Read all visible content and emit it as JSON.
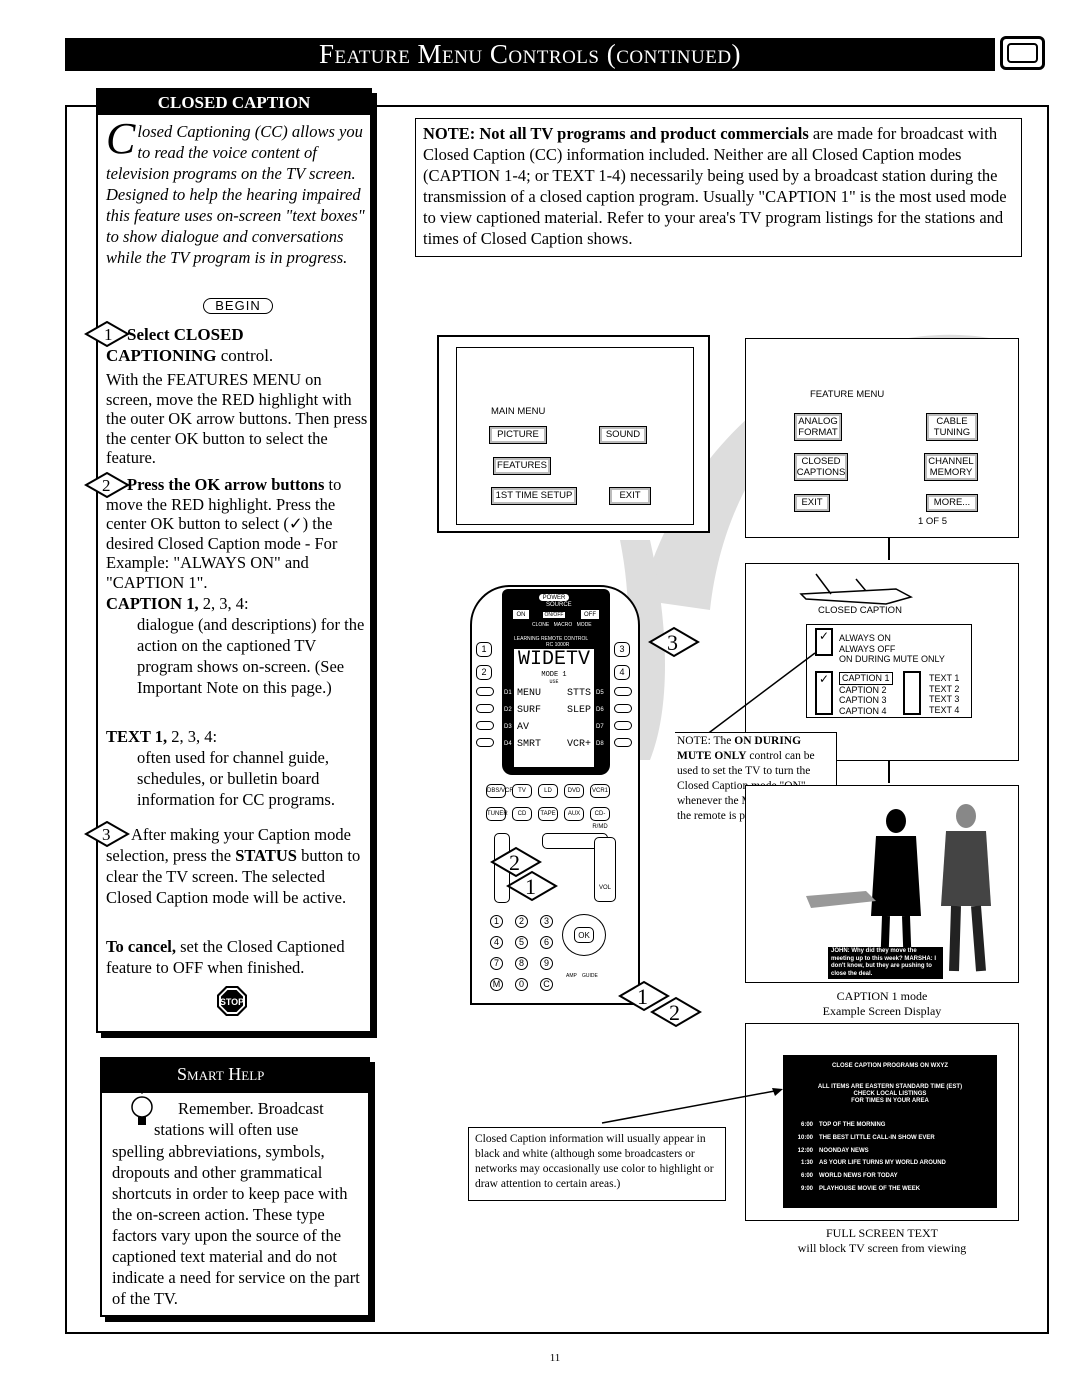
{
  "header": {
    "title": "Feature Menu Controls (continued)",
    "icon": "tv-icon"
  },
  "closed_caption": {
    "heading": "CLOSED CAPTION",
    "intro_dropcap": "C",
    "intro": "losed Captioning (CC) allows you to read the voice content of television programs on the TV screen. Designed to help the hearing impaired this feature uses on-screen \"text boxes\" to show dialogue and conversations while the TV program is in progress.",
    "begin": "BEGIN",
    "step1_num": "1",
    "step1_title_a": "Select CLOSED",
    "step1_title_b": "CAPTIONING",
    "step1_title_c": " control.",
    "step1_body": "With the FEATURES MENU on screen, move the RED highlight with the outer OK arrow buttons. Then press the center OK button to select the feature.",
    "step2_num": "2",
    "step2_title": "Press the OK arrow buttons",
    "step2_body": " to move the RED highlight. Press the center OK button to select (✓) the desired Closed Caption mode - For Example: \"ALWAYS ON\" and \"CAPTION 1\".",
    "caption_label": "CAPTION 1,",
    "caption_rest": " 2, 3, 4:",
    "caption_desc": "dialogue (and descriptions) for the action on the captioned TV program shows on-screen. (See Important Note on this page.)",
    "text_label": "TEXT 1,",
    "text_rest": " 2, 3, 4:",
    "text_desc": "often used for channel guide, schedules, or bulletin board information for CC programs.",
    "step3_num": "3",
    "step3_a": "After making your Caption mode selection, press the ",
    "step3_b": "STATUS",
    "step3_c": " button to clear the TV screen. The selected Closed Caption mode will be active.",
    "cancel_a": "To cancel,",
    "cancel_b": " set the Closed Captioned feature to OFF when finished.",
    "stop": "STOP"
  },
  "smart_help": {
    "heading": "Smart Help",
    "body_first": "Remember.  Broadcast",
    "body_second": "stations will often use",
    "body": "spelling abbreviations, symbols, dropouts and other grammatical shortcuts in order to keep pace with the on-screen action. These type factors vary upon the source of the captioned text material and do not indicate a need for service on the part of the TV."
  },
  "note": {
    "bold": "NOTE: Not all TV programs and product commercials",
    "text": " are made for broadcast with Closed Caption (CC) information included. Neither are all Closed Caption modes (CAPTION 1-4; or TEXT 1-4) necessarily being used by a broadcast station during the transmission of a closed caption program. Usually \"CAPTION 1\" is the most used mode to view captioned material. Refer to your area's TV program listings for the stations and times of Closed Caption shows."
  },
  "main_menu": {
    "title": "MAIN MENU",
    "items": [
      "PICTURE",
      "SOUND",
      "FEATURES",
      "1ST TIME SETUP",
      "EXIT"
    ]
  },
  "feature_menu": {
    "title": "FEATURE MENU",
    "items": [
      "ANALOG FORMAT",
      "CABLE TUNING",
      "CLOSED CAPTIONS",
      "CHANNEL MEMORY",
      "EXIT",
      "MORE..."
    ],
    "page": "1 OF 5"
  },
  "cc_menu": {
    "title": "CLOSED CAPTION",
    "modes": [
      "ALWAYS ON",
      "ALWAYS OFF",
      "ON DURING MUTE ONLY"
    ],
    "captions": [
      "CAPTION 1",
      "CAPTION 2",
      "CAPTION 3",
      "CAPTION 4"
    ],
    "texts": [
      "TEXT 1",
      "TEXT 2",
      "TEXT 3",
      "TEXT 4"
    ]
  },
  "mute_note": {
    "a": "NOTE: The ",
    "b": "ON DURING MUTE ONLY",
    "c": " control can be used to set the TV to turn the Closed Caption mode \"ON\" whenever the MUTE button on the remote is pressed."
  },
  "example": {
    "caption_text": "JOHN: Why did they move the meeting up to this week? MARSHA: I don't know, but they are pushing to close the deal.",
    "label1": "CAPTION 1 mode",
    "label2": "Example Screen Display"
  },
  "full_screen": {
    "title": "CLOSE CAPTION PROGRAMS ON WXYZ",
    "info": [
      "ALL ITEMS ARE EASTERN STANDARD TIME (EST)",
      "CHECK LOCAL LISTINGS",
      "FOR TIMES IN YOUR AREA"
    ],
    "listings": [
      {
        "time": "6:00",
        "show": "TOP OF THE MORNING"
      },
      {
        "time": "10:00",
        "show": "THE BEST LITTLE CALL-IN SHOW EVER"
      },
      {
        "time": "12:00",
        "show": "NOONDAY NEWS"
      },
      {
        "time": "1:30",
        "show": "AS YOUR LIFE TURNS MY WORLD AROUND"
      },
      {
        "time": "6:00",
        "show": "WORLD NEWS FOR TODAY"
      },
      {
        "time": "9:00",
        "show": "PLAYHOUSE MOVIE OF THE WEEK"
      }
    ],
    "label1": "FULL SCREEN TEXT",
    "label2": "will block TV screen from viewing"
  },
  "info_box": "Closed Caption information will usually appear in black and white (although some broadcasters or networks may occasionally use color to highlight or draw attention to certain areas.)",
  "remote": {
    "power": "POWER",
    "source": "SOURCE",
    "on": "ON",
    "onoff": "ON/OFF",
    "off": "OFF",
    "clone": "CLONE",
    "macro": "MACRO",
    "mode": "MODE",
    "learning": "LEARNING REMOTE CONTROL",
    "model": "RC 1000R",
    "lcd_title": "WIDETV",
    "lcd_mode": "MODE 1",
    "lcd_use": "USE",
    "lcd_left": [
      "MENU",
      "SURF",
      "AV",
      "SMRT"
    ],
    "lcd_right": [
      "STTS",
      "SLEP",
      "",
      "VCR+"
    ],
    "dl": [
      "D1",
      "D2",
      "D3",
      "D4"
    ],
    "dr": [
      "D5",
      "D6",
      "D7",
      "D8"
    ],
    "macro_nums": [
      "1",
      "2",
      "3",
      "4"
    ],
    "src1": [
      "DBS/VCR2",
      "TV",
      "LD",
      "DVD",
      "VCR1"
    ],
    "src2": [
      "TUNER",
      "CD",
      "TAPE",
      "AUX",
      "CD-R/MD"
    ],
    "vol": "VOL",
    "ok": "OK",
    "amp": "AMP",
    "guide": "GUIDE",
    "keypad": [
      "1",
      "2",
      "3",
      "4",
      "5",
      "6",
      "7",
      "8",
      "9",
      "M",
      "0",
      "C"
    ],
    "callouts": [
      "3",
      "2",
      "1",
      "1",
      "2"
    ]
  },
  "page_number": "11"
}
